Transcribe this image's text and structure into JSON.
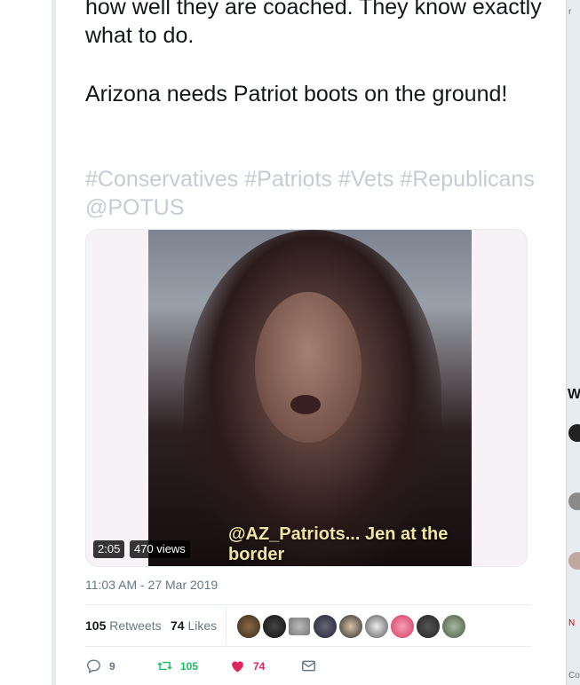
{
  "tweet": {
    "text_top": "how well they are coached. They know exactly what to do.",
    "text_main": "Arizona needs Patriot boots on the ground!",
    "hashtags": "#Conservatives #Patriots #Vets #Republicans @POTUS",
    "timestamp": "11:03 AM - 27 Mar 2019"
  },
  "video": {
    "caption": "@AZ_Patriots... Jen at the border",
    "duration": "2:05",
    "views": "470 views"
  },
  "stats": {
    "retweets_count": "105",
    "retweets_label": "Retweets",
    "likes_count": "74",
    "likes_label": "Likes"
  },
  "actions": {
    "reply_count": "9",
    "retweet_count": "105",
    "like_count": "74"
  },
  "right_panel": {
    "fragment_top": "r",
    "fragment_w": "W",
    "fragment_n": "N",
    "fragment_bottom": "Co"
  },
  "colors": {
    "text": "#14171a",
    "secondary": "#657786",
    "hashtag_faded": "#c5ccd3",
    "retweet_green": "#17bf63",
    "like_red": "#e0245e",
    "border": "#e6ecf0"
  },
  "icons": [
    "reply-icon",
    "retweet-icon",
    "heart-icon",
    "direct-message-icon"
  ]
}
